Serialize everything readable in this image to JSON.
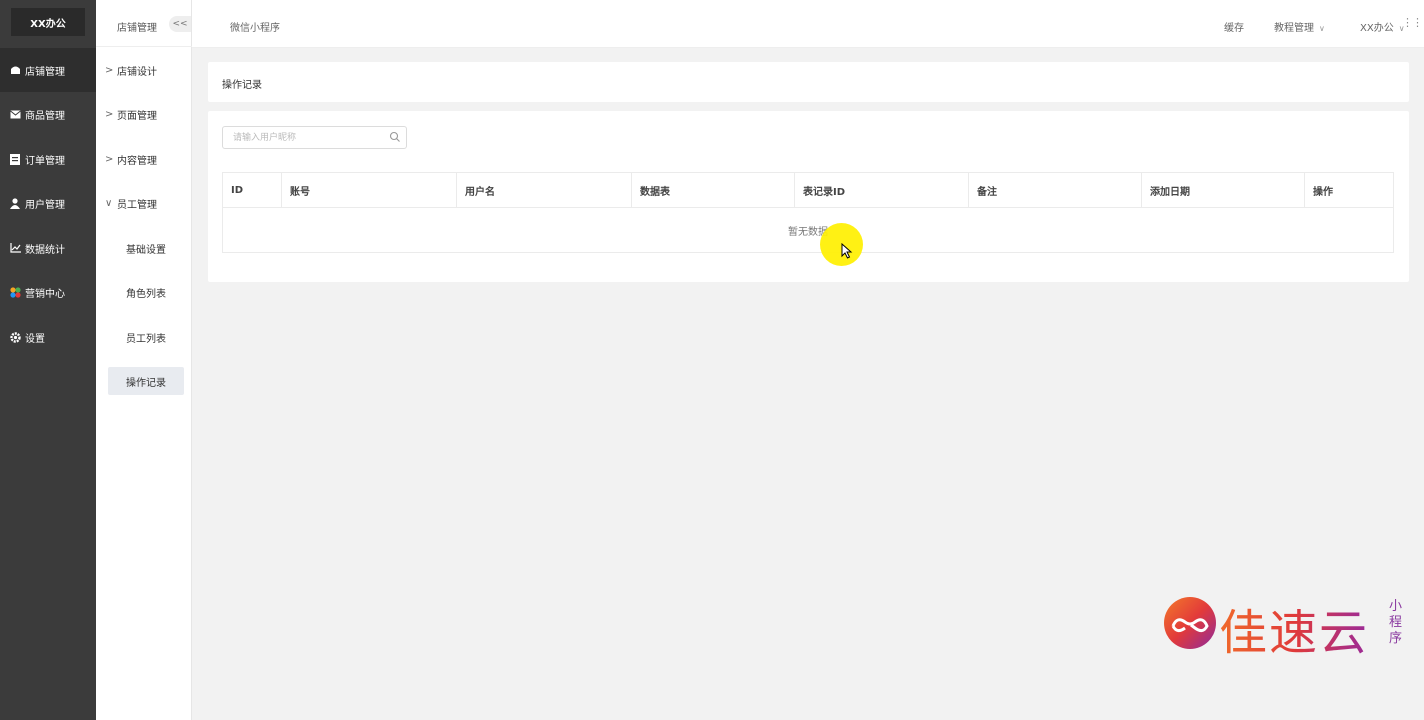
{
  "brand": "XX办公",
  "sidebar": {
    "items": [
      {
        "label": "店铺管理",
        "icon": "store-icon"
      },
      {
        "label": "商品管理",
        "icon": "mail-icon"
      },
      {
        "label": "订单管理",
        "icon": "list-icon"
      },
      {
        "label": "用户管理",
        "icon": "user-icon"
      },
      {
        "label": "数据统计",
        "icon": "chart-icon"
      },
      {
        "label": "营销中心",
        "icon": "marketing-icon"
      },
      {
        "label": "设置",
        "icon": "gear-icon"
      }
    ]
  },
  "subnav": {
    "title": "店铺管理",
    "collapse_label": "<<",
    "groups": [
      {
        "label": "店铺设计",
        "arrow": ">"
      },
      {
        "label": "页面管理",
        "arrow": ">"
      },
      {
        "label": "内容管理",
        "arrow": ">"
      },
      {
        "label": "员工管理",
        "arrow": "∨"
      }
    ],
    "leaves": [
      "基础设置",
      "角色列表",
      "员工列表",
      "操作记录"
    ]
  },
  "topbar": {
    "title": "微信小程序",
    "cache": "缓存",
    "tutorial": "教程管理",
    "account": "XX办公"
  },
  "page": {
    "title": "操作记录",
    "search_placeholder": "请输入用户昵称",
    "columns": [
      "ID",
      "账号",
      "用户名",
      "数据表",
      "表记录ID",
      "备注",
      "添加日期",
      "操作"
    ],
    "empty_text": "暂无数据"
  },
  "watermark": {
    "text": "佳速云",
    "sub": "小程序"
  },
  "colors": {
    "sidebar_bg": "#3b3b3b",
    "active_leaf_bg": "#e8ebf0",
    "cursor_highlight": "#fff000"
  }
}
